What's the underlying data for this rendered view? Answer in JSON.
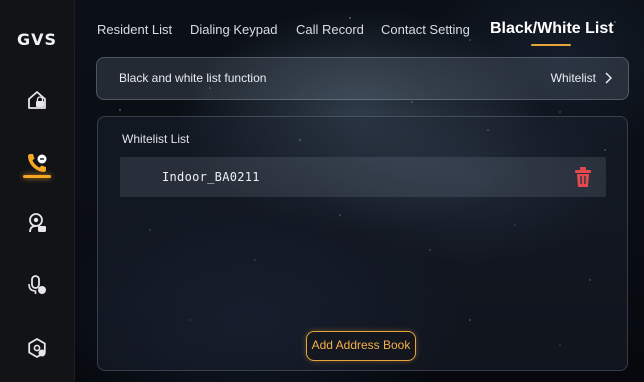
{
  "sidebar": {
    "logo": "GVS",
    "items": [
      {
        "icon": "home-lock-icon"
      },
      {
        "icon": "phone-call-icon",
        "active": true
      },
      {
        "icon": "camera-person-icon"
      },
      {
        "icon": "intercom-mic-icon"
      },
      {
        "icon": "settings-gear-icon"
      }
    ],
    "accent_color": "#f5a623"
  },
  "tabs": [
    {
      "label": "Resident List"
    },
    {
      "label": "Dialing Keypad"
    },
    {
      "label": "Call Record"
    },
    {
      "label": "Contact Setting"
    },
    {
      "label": "Black/White List",
      "active": true
    }
  ],
  "function_row": {
    "label": "Black and white list function",
    "value": "Whitelist",
    "chevron_icon": "chevron-right-icon"
  },
  "whitelist": {
    "title": "Whitelist List",
    "entries": [
      {
        "name": "Indoor_BA0211",
        "delete_icon": "trash-icon"
      }
    ],
    "add_button": "Add Address Book"
  },
  "colors": {
    "accent": "#e8a33a",
    "delete": "#e5484d",
    "sidebar_bg": "#111317"
  }
}
